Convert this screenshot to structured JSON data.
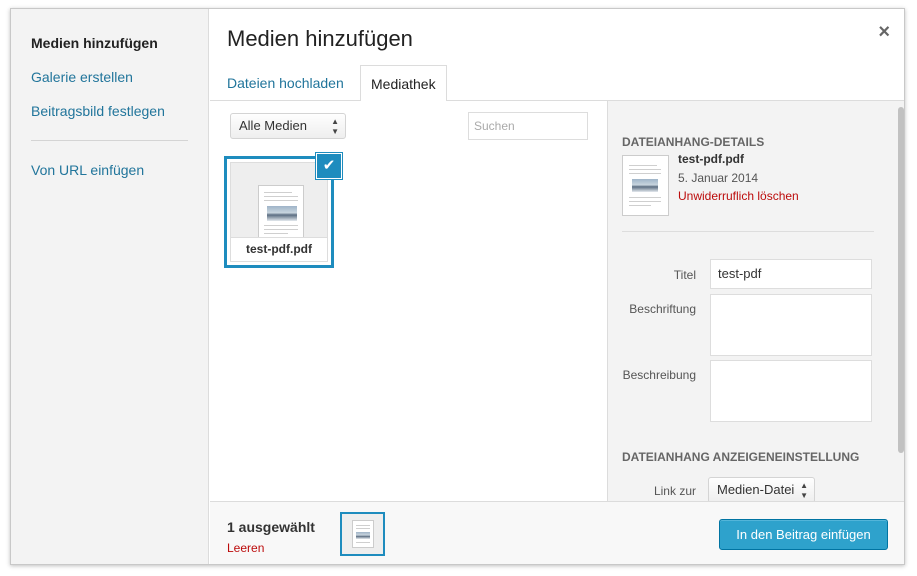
{
  "menu": {
    "items": [
      {
        "label": "Medien hinzufügen"
      },
      {
        "label": "Galerie erstellen"
      },
      {
        "label": "Beitragsbild festlegen"
      },
      {
        "label": "Von URL einfügen"
      }
    ]
  },
  "frame": {
    "title": "Medien hinzufügen",
    "close": "×"
  },
  "tabs": [
    {
      "label": "Dateien hochladen"
    },
    {
      "label": "Mediathek"
    }
  ],
  "browser": {
    "filter_value": "Alle Medien",
    "search_placeholder": "Suchen",
    "attachments": [
      {
        "name": "test-pdf.pdf",
        "selected": true,
        "check": "✔"
      }
    ]
  },
  "details": {
    "heading": "DATEIANHANG-DETAILS",
    "filename": "test-pdf.pdf",
    "date": "5. Januar 2014",
    "delete_label": "Unwiderruflich löschen",
    "fields": {
      "title_label": "Titel",
      "title_value": "test-pdf",
      "caption_label": "Beschriftung",
      "caption_value": "",
      "description_label": "Beschreibung",
      "description_value": ""
    },
    "display_heading": "DATEIANHANG ANZEIGENEINSTELLUNG",
    "link_label": "Link zur",
    "link_value": "Medien-Datei"
  },
  "toolbar": {
    "selected_count": "1 ausgewählt",
    "clear_label": "Leeren",
    "insert_label": "In den Beitrag einfügen"
  },
  "colors": {
    "accent": "#1e8cbe",
    "link": "#21759b",
    "danger": "#bc0b0b",
    "primary_button": "#2ea2cc"
  }
}
